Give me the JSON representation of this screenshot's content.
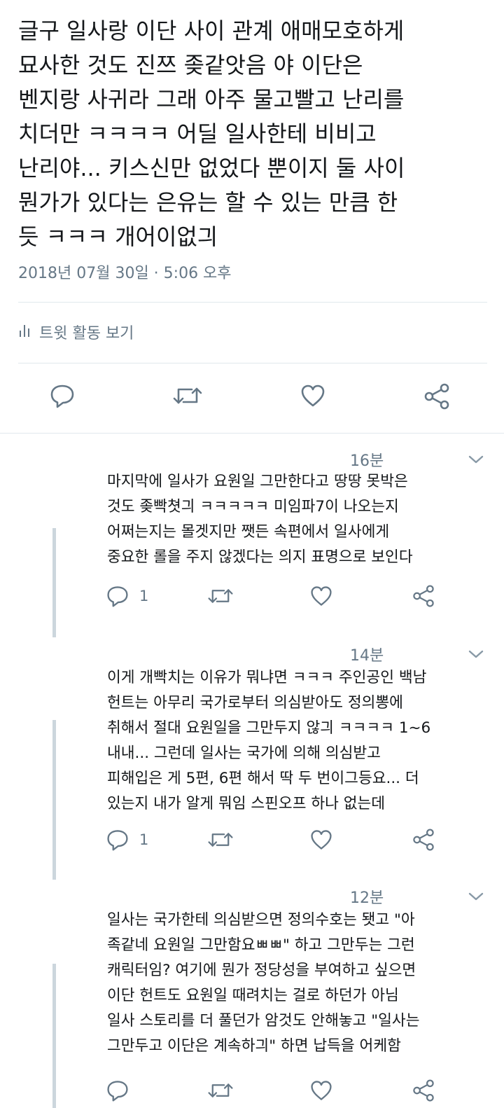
{
  "main_tweet": {
    "text_lines": [
      "글구 일사랑 이단 사이 관계 애매모호하게",
      "묘사한 것도 진쯔 좆같앗음 야 이단은",
      "벤지랑 사귀라 그래 아주 물고빨고 난리를",
      "치더만 ㅋㅋㅋㅋ 어딜 일사한테 비비고",
      "난리야... 키스신만 없었다 뿐이지 둘 사이",
      "뭔가가 있다는 은유는 할 수 있는 만큼 한",
      "듯 ㅋㅋㅋ 개어이없긔"
    ],
    "timestamp": "2018년 07월 30일 · 5:06 오후",
    "activity_label": "트윗 활동 보기",
    "activity_icon": "bar-chart-icon",
    "actions": [
      "reply-icon",
      "retweet-icon",
      "like-icon",
      "share-icon"
    ]
  },
  "replies": [
    {
      "time": "16분",
      "text_lines": [
        "마지막에 일사가 요원일 그만한다고 땅땅 못박은",
        "것도 좆빡쳣긔 ㅋㅋㅋㅋㅋ 미임파7이 나오는지",
        "어쩌는지는 몰겟지만 쨋든 속편에서 일사에게",
        "중요한 롤을 주지 않겠다는 의지 표명으로 보인다"
      ],
      "reply_count": "1"
    },
    {
      "time": "14분",
      "text_lines": [
        "이게 개빡치는 이유가 뭐냐면 ㅋㅋㅋ 주인공인 백남",
        "헌트는 아무리 국가로부터 의심받아도 정의뽕에",
        "취해서 절대 요원일을 그만두지 않긔 ㅋㅋㅋㅋ 1~6",
        "내내... 그런데 일사는 국가에 의해 의심받고",
        "피해입은 게 5편, 6편 해서 딱 두 번이그등요... 더",
        "있는지 내가 알게 뭐임 스핀오프 하나 없는데"
      ],
      "reply_count": "1"
    },
    {
      "time": "12분",
      "text_lines": [
        "일사는 국가한테 의심받으면 정의수호는 됏고 \"아",
        "족같네 요원일 그만함요ㅃㅃ\" 하고 그만두는 그런",
        "캐릭터임? 여기에 뭔가 정당성을 부여하고 싶으면",
        "이단 헌트도 요원일 때려치는 걸로 하던가 아님",
        "일사 스토리를 더 풀던가 암것도 안해놓고 \"일사는",
        "그만두고 이단은 계속하긔\" 하면 납득을 어케함"
      ],
      "reply_count": ""
    }
  ],
  "colors": {
    "text": "#14171a",
    "secondary": "#657786",
    "divider": "#e1e8ed",
    "thread_line": "#ccd6dd"
  }
}
